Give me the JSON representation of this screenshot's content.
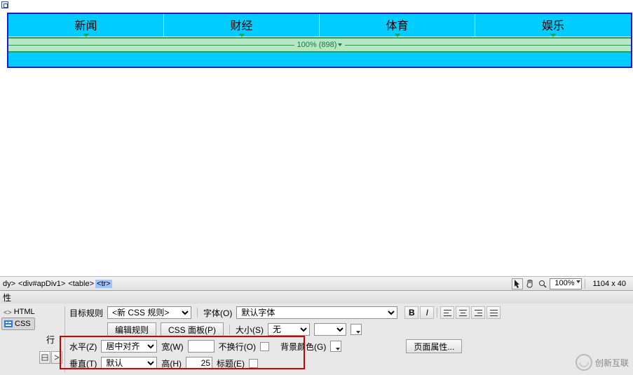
{
  "nav": {
    "items": [
      {
        "label": "新闻"
      },
      {
        "label": "财经"
      },
      {
        "label": "体育"
      },
      {
        "label": "娱乐"
      }
    ],
    "width_indicator": "100% (898)"
  },
  "tagbar": {
    "path": [
      "dy>",
      "<div#apDiv1>",
      "<table>",
      "<tr>"
    ],
    "zoom": "100%",
    "dimensions": "1104 x 40"
  },
  "properties": {
    "panel_title": "性",
    "mode_html": "HTML",
    "mode_css": "CSS",
    "row_label": "行",
    "target_rule_label": "目标规则",
    "target_rule_value": "<新 CSS 规则>",
    "edit_rule_btn": "编辑规则",
    "css_panel_btn": "CSS 面板(P)",
    "font_label": "字体(O)",
    "font_value": "默认字体",
    "size_label": "大小(S)",
    "size_value": "无",
    "bold": "B",
    "italic": "I",
    "horiz_label": "水平(Z)",
    "horiz_value": "居中对齐",
    "width_label": "宽(W)",
    "width_value": "",
    "nowrap_label": "不换行(O)",
    "bg_label": "背景颜色(G)",
    "page_props_btn": "页面属性...",
    "vert_label": "垂直(T)",
    "vert_value": "默认",
    "height_label": "高(H)",
    "height_value": "25",
    "header_label": "标题(E)"
  },
  "watermark": {
    "text": "创新互联"
  }
}
